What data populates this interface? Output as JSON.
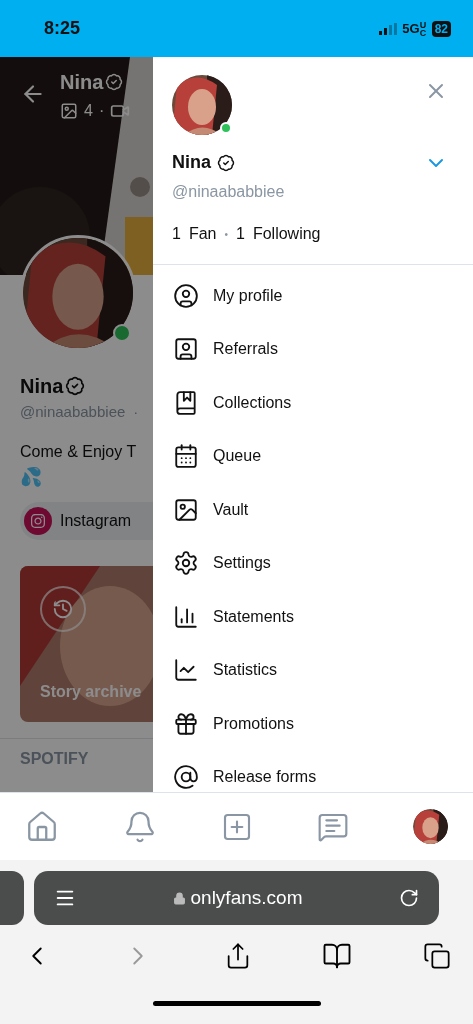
{
  "status_bar": {
    "time": "8:25",
    "network": "5G",
    "network_suffix": "UC",
    "battery": "82"
  },
  "profile_page": {
    "header_name": "Nina",
    "media_count": "4",
    "media_separator": "·",
    "name": "Nina",
    "username": "@ninaababbiee",
    "username_separator": "·",
    "online": true,
    "bio": "Come & Enjoy T",
    "bio_emoji": "💦",
    "links": [
      {
        "label": "Instagram"
      }
    ],
    "story_label": "Story archive",
    "section_title": "SPOTIFY"
  },
  "menu": {
    "name": "Nina",
    "username": "@ninaababbiee",
    "online": true,
    "fans_count": "1",
    "fans_label": "Fan",
    "stats_separator": "•",
    "following_count": "1",
    "following_label": "Following",
    "items": [
      {
        "kind": "profile",
        "label": "My profile"
      },
      {
        "kind": "referrals",
        "label": "Referrals"
      },
      {
        "kind": "collections",
        "label": "Collections"
      },
      {
        "kind": "queue",
        "label": "Queue"
      },
      {
        "kind": "vault",
        "label": "Vault"
      },
      {
        "kind": "settings",
        "label": "Settings"
      },
      {
        "kind": "statements",
        "label": "Statements"
      },
      {
        "kind": "statistics",
        "label": "Statistics"
      },
      {
        "kind": "promotions",
        "label": "Promotions"
      },
      {
        "kind": "release_forms",
        "label": "Release forms"
      }
    ]
  },
  "browser": {
    "url": "onlyfans.com"
  }
}
